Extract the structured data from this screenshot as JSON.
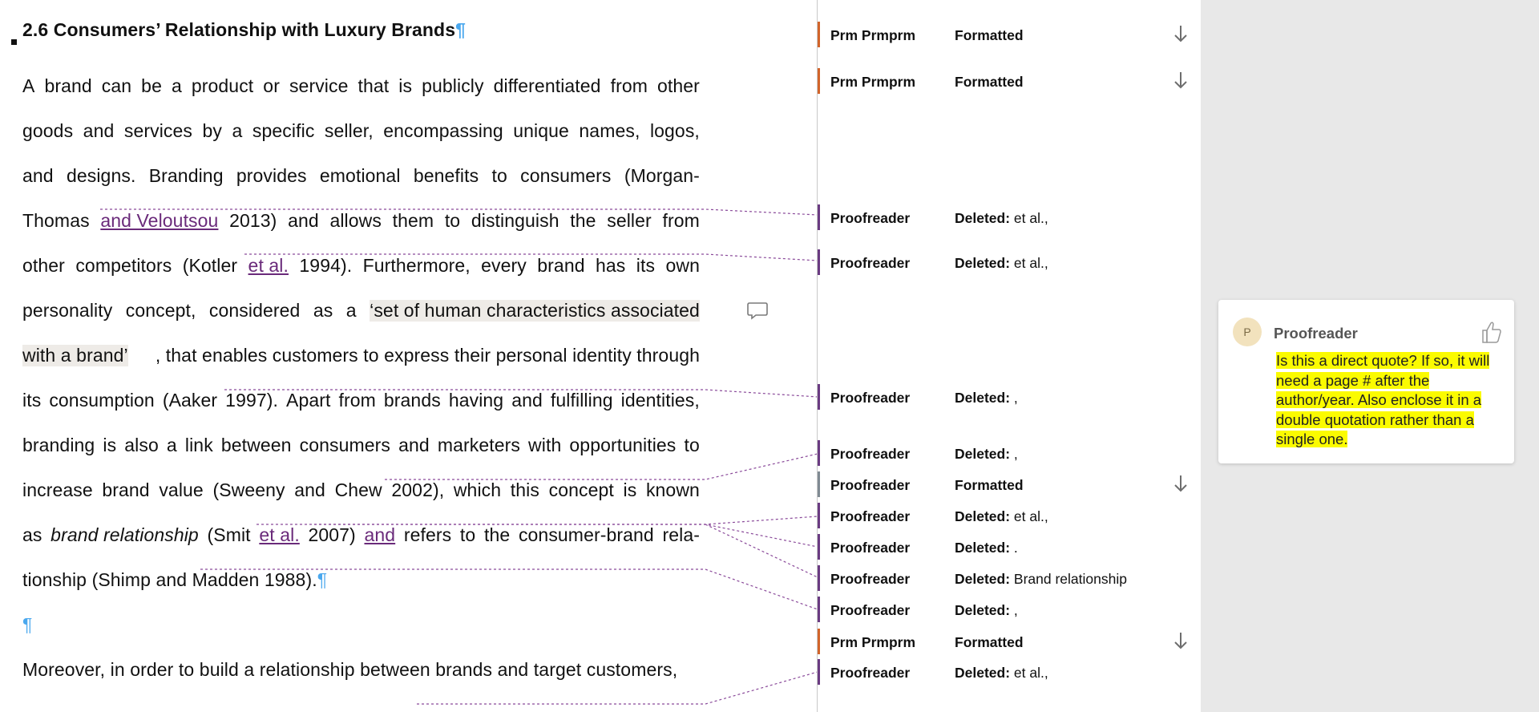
{
  "document": {
    "heading": "2.6 Consumers’ Relationship with Luxury Brands",
    "pilcrow": "¶",
    "paragraph1": [
      [
        "A",
        "brand",
        "can",
        "be",
        "a",
        "product",
        "or",
        "service",
        "that",
        "is",
        "publicly",
        "differentiated",
        "from",
        "other"
      ],
      [
        "goods",
        "and",
        "services",
        "by",
        "a",
        "specific",
        "seller,",
        "encompassing",
        "unique",
        "names,",
        "logos,"
      ],
      [
        "and",
        "designs.",
        "Branding",
        "provides",
        "emotional",
        "benefits",
        "to",
        "consumers",
        "(Morgan-"
      ],
      [
        "Thomas",
        "and Veloutsou",
        "2013)",
        "and",
        "allows",
        "them",
        "to",
        "distinguish",
        "the",
        "seller",
        "from"
      ],
      [
        "other",
        "competitors",
        "(Kotler",
        "et al.",
        "1994).",
        "Furthermore,",
        "every",
        "brand",
        "has",
        "its",
        "own"
      ],
      [
        "personality",
        "concept,",
        "considered",
        "as",
        "a",
        "‘set of human characteristics associated"
      ],
      [
        "with a brand’",
        ", that enables customers to express their personal identity through"
      ],
      [
        "its",
        "consumption",
        "(Aaker",
        "1997).",
        "Apart",
        "from",
        "brands",
        "having",
        "and",
        "fulfilling",
        "identities,"
      ],
      [
        "branding",
        "is",
        "also",
        "a",
        "link",
        "between",
        "consumers",
        "and",
        "marketers",
        "with",
        "opportunities",
        "to"
      ],
      [
        "increase",
        "brand",
        "value",
        "(Sweeny",
        "and",
        "Chew",
        "2002),",
        "which",
        "this",
        "concept",
        "is",
        "known"
      ],
      [
        "as",
        "brand relationship",
        "(Smit",
        "et al.",
        "2007)",
        "and",
        "refers",
        "to",
        "the",
        "consumer-brand",
        "rela-"
      ],
      [
        "tionship (Shimp and Madden 1988)."
      ]
    ],
    "empty_para_mark": "¶",
    "paragraph2_line1": "Moreover, in order to build a relationship between brands and target customers,"
  },
  "revisions": [
    {
      "author": "Prm Prmprm",
      "action": "Formatted",
      "detail": "",
      "arrow": true
    },
    {
      "author": "Prm Prmprm",
      "action": "Formatted",
      "detail": "",
      "arrow": true
    },
    {
      "author": "Proofreader",
      "action": "Deleted:",
      "detail": "et al.,",
      "arrow": false
    },
    {
      "author": "Proofreader",
      "action": "Deleted:",
      "detail": "et al.,",
      "arrow": false
    },
    {
      "author": "Proofreader",
      "action": "Deleted:",
      "detail": ",",
      "arrow": false
    },
    {
      "author": "Proofreader",
      "action": "Deleted:",
      "detail": ",",
      "arrow": false
    },
    {
      "author": "Proofreader",
      "action": "Formatted",
      "detail": "",
      "arrow": true
    },
    {
      "author": "Proofreader",
      "action": "Deleted:",
      "detail": "et al.,",
      "arrow": false
    },
    {
      "author": "Proofreader",
      "action": "Deleted:",
      "detail": ".",
      "arrow": false
    },
    {
      "author": "Proofreader",
      "action": "Deleted:",
      "detail": "Brand relationship",
      "arrow": false
    },
    {
      "author": "Proofreader",
      "action": "Deleted:",
      "detail": ",",
      "arrow": false
    },
    {
      "author": "Prm Prmprm",
      "action": "Formatted",
      "detail": "",
      "arrow": true
    },
    {
      "author": "Proofreader",
      "action": "Deleted:",
      "detail": "et al.,",
      "arrow": false
    }
  ],
  "comment": {
    "avatar_initial": "P",
    "author": "Proofreader",
    "text": "Is this a direct quote? If so, it will need a page # after the author/year. Also enclose it in a double quotation rather than a single one."
  },
  "colors": {
    "prm_bar": "#d2642a",
    "proofreader_bar": "#6a3b82",
    "formatted_proof_bar": "#808a93",
    "connector": "#8a4a9a",
    "comment_highlight": "#fbfb00",
    "pilcrow": "#4aa8ee"
  }
}
